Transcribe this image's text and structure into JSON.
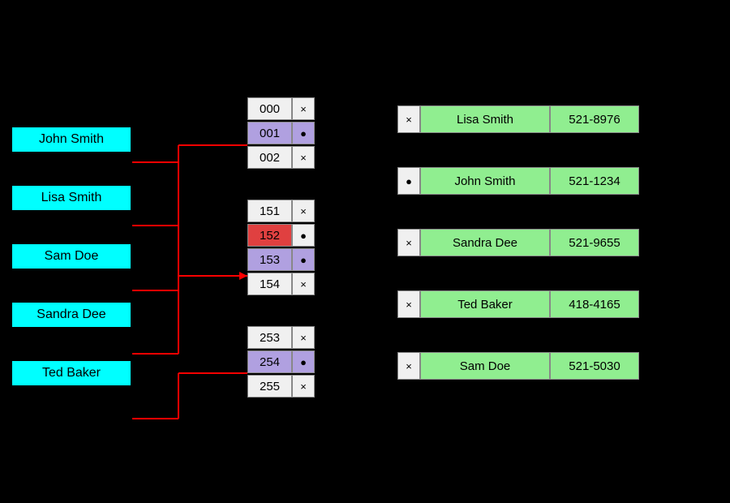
{
  "names": [
    {
      "label": "John Smith"
    },
    {
      "label": "Lisa Smith"
    },
    {
      "label": "Sam Doe"
    },
    {
      "label": "Sandra Dee"
    },
    {
      "label": "Ted Baker"
    }
  ],
  "bucket_groups": [
    {
      "rows": [
        {
          "id": "000",
          "style": "normal",
          "icon": "x"
        },
        {
          "id": "001",
          "style": "purple",
          "icon": "dot"
        },
        {
          "id": "002",
          "style": "normal",
          "icon": "x"
        }
      ]
    },
    {
      "rows": [
        {
          "id": "151",
          "style": "normal",
          "icon": "x"
        },
        {
          "id": "152",
          "style": "red",
          "icon": "dot-arrow"
        },
        {
          "id": "153",
          "style": "purple",
          "icon": "dot"
        },
        {
          "id": "154",
          "style": "normal",
          "icon": "x"
        }
      ]
    },
    {
      "rows": [
        {
          "id": "253",
          "style": "normal",
          "icon": "x"
        },
        {
          "id": "254",
          "style": "purple",
          "icon": "dot"
        },
        {
          "id": "255",
          "style": "normal",
          "icon": "x"
        }
      ]
    }
  ],
  "results": [
    {
      "icon": "x",
      "name": "Lisa Smith",
      "phone": "521-8976"
    },
    {
      "icon": "dot",
      "name": "John Smith",
      "phone": "521-1234"
    },
    {
      "icon": "x",
      "name": "Sandra Dee",
      "phone": "521-9655"
    },
    {
      "icon": "x",
      "name": "Ted Baker",
      "phone": "418-4165"
    },
    {
      "icon": "x",
      "name": "Sam Doe",
      "phone": "521-5030"
    }
  ],
  "icons": {
    "x": "×",
    "dot": "●",
    "dot_arrow": "●"
  }
}
